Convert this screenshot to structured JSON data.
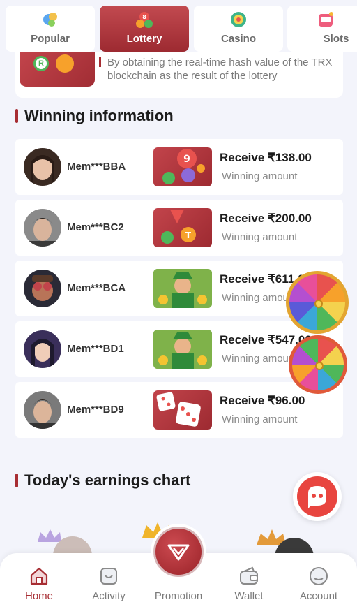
{
  "categories": [
    {
      "label": "Popular",
      "icon": "popular-icon"
    },
    {
      "label": "Lottery",
      "icon": "lottery-icon",
      "active": true
    },
    {
      "label": "Casino",
      "icon": "casino-icon"
    },
    {
      "label": "Slots",
      "icon": "slots-icon"
    }
  ],
  "lottery_description": "By obtaining the real-time hash value of the TRX blockchain as the result of the lottery",
  "winning_section": {
    "title": "Winning information",
    "rows": [
      {
        "member": "Mem***BBA",
        "receive": "Receive ₹138.00",
        "amount_label": "Winning amount",
        "game": "lottery-balls"
      },
      {
        "member": "Mem***BC2",
        "receive": "Receive ₹200.00",
        "amount_label": "Winning amount",
        "game": "trx-lottery"
      },
      {
        "member": "Mem***BCA",
        "receive": "Receive ₹611.00",
        "amount_label": "Winning amount",
        "game": "slot-leprechaun"
      },
      {
        "member": "Mem***BD1",
        "receive": "Receive ₹547.00",
        "amount_label": "Winning amount",
        "game": "slot-leprechaun"
      },
      {
        "member": "Mem***BD9",
        "receive": "Receive ₹96.00",
        "amount_label": "Winning amount",
        "game": "dice"
      }
    ]
  },
  "earnings_section": {
    "title": "Today's earnings chart"
  },
  "bottom_nav": [
    {
      "label": "Home",
      "icon": "home-icon",
      "active": true
    },
    {
      "label": "Activity",
      "icon": "activity-icon"
    },
    {
      "label": "Promotion",
      "icon": "promotion-icon"
    },
    {
      "label": "Wallet",
      "icon": "wallet-icon"
    },
    {
      "label": "Account",
      "icon": "account-icon"
    }
  ],
  "colors": {
    "accent": "#a72d33",
    "background": "#f3f4fb",
    "card": "#ffffff"
  }
}
